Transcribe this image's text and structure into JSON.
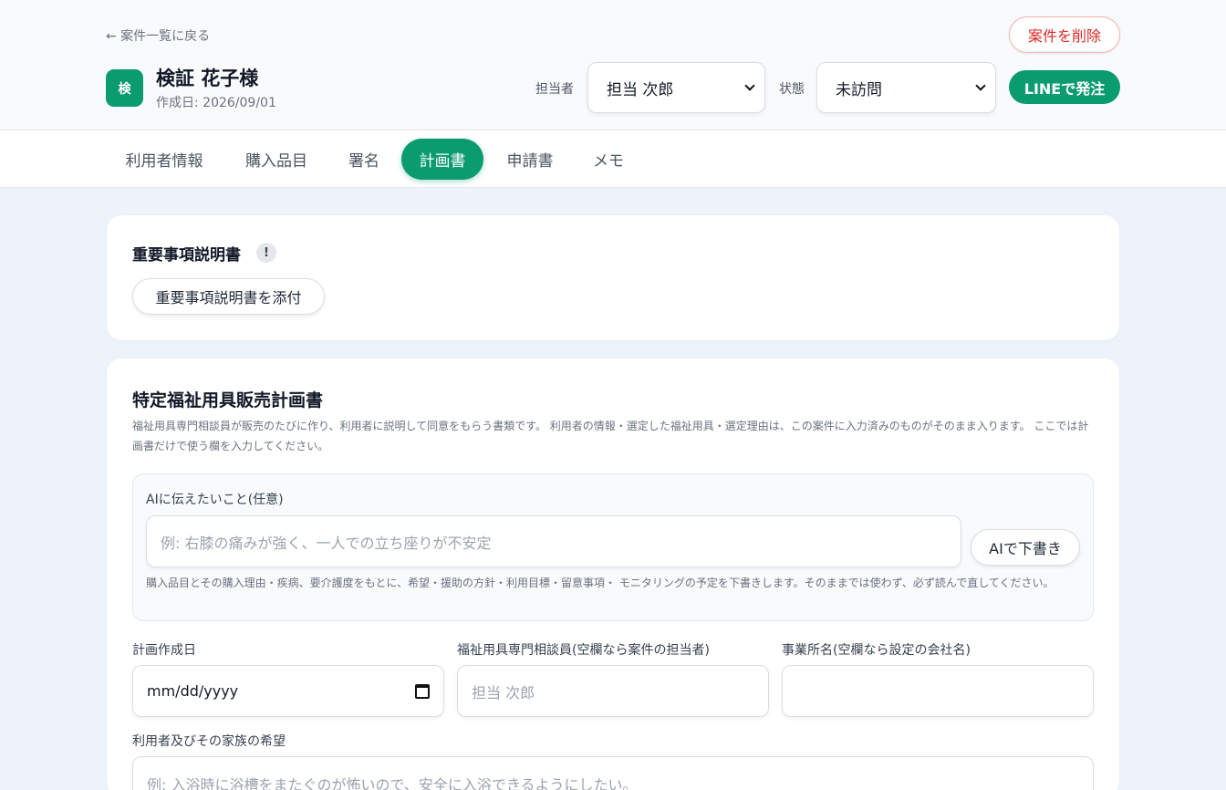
{
  "header": {
    "back_label": "← 案件一覧に戻る",
    "delete_label": "案件を削除",
    "avatar_char": "検",
    "case_name": "検証 花子様",
    "created_label": "作成日: 2026/09/01",
    "assignee_label": "担当者",
    "assignee_value": "担当 次郎",
    "status_label": "状態",
    "status_value": "未訪問",
    "line_order_label": "LINEで発注"
  },
  "tabs": [
    {
      "label": "利用者情報"
    },
    {
      "label": "購入品目"
    },
    {
      "label": "署名"
    },
    {
      "label": "計画書"
    },
    {
      "label": "申請書"
    },
    {
      "label": "メモ"
    }
  ],
  "active_tab": "計画書",
  "important": {
    "title": "重要事項説明書",
    "badge": "!",
    "attach_label": "重要事項説明書を添付"
  },
  "plan": {
    "title": "特定福祉用具販売計画書",
    "description": "福祉用具専門相談員が販売のたびに作り、利用者に説明して同意をもらう書類です。 利用者の情報・選定した福祉用具・選定理由は、この案件に入力済みのものがそのまま入ります。 ここでは計画書だけで使う欄を入力してください。",
    "ai": {
      "label": "AIに伝えたいこと(任意)",
      "placeholder": "例: 右膝の痛みが強く、一人での立ち座りが不安定",
      "button_label": "AIで下書き",
      "note": "購入品目とその購入理由・疾病、要介護度をもとに、希望・援助の方針・利用目標・留意事項・ モニタリングの予定を下書きします。そのままでは使わず、必ず読んで直してください。"
    },
    "date_label": "計画作成日",
    "date_placeholder": "mm/dd/yyyy",
    "consultant_label": "福祉用具専門相談員(空欄なら案件の担当者)",
    "consultant_placeholder": "担当 次郎",
    "office_label": "事業所名(空欄なら設定の会社名)",
    "office_value": "",
    "wish_label": "利用者及びその家族の希望",
    "wish_placeholder": "例: 入浴時に浴槽をまたぐのが怖いので、安全に入浴できるようにしたい。"
  }
}
